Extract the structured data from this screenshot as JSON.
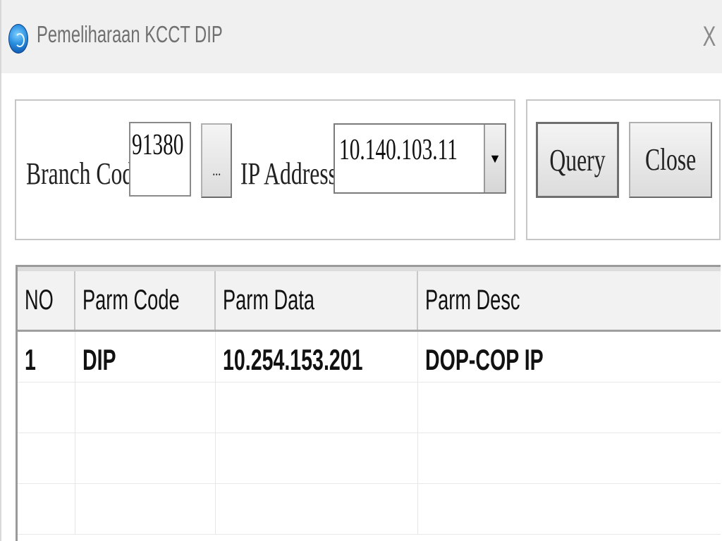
{
  "window": {
    "title": "Pemeliharaan KCCT DIP",
    "close_glyph": "X"
  },
  "form": {
    "branch_label": "Branch Code",
    "branch_value": "91380",
    "browse_label": "...",
    "ip_label": "IP Address",
    "ip_value": "10.140.103.11",
    "ip_arrow": "▼",
    "query_label": "Query",
    "close_label": "Close"
  },
  "table": {
    "headers": [
      "NO",
      "Parm Code",
      "Parm Data",
      "Parm Desc"
    ],
    "rows": [
      [
        "1",
        "DIP",
        "10.254.153.201",
        "DOP-COP IP"
      ],
      [
        "",
        "",
        "",
        ""
      ],
      [
        "",
        "",
        "",
        ""
      ],
      [
        "",
        "",
        "",
        ""
      ]
    ]
  },
  "colors": {
    "titlebar_bg": "#f0f0f0",
    "title_text": "#707070",
    "grid_border": "#9a9a9a"
  },
  "icons": {
    "app": "app-globe-icon",
    "close": "close-icon",
    "dropdown": "chevron-down-icon"
  }
}
